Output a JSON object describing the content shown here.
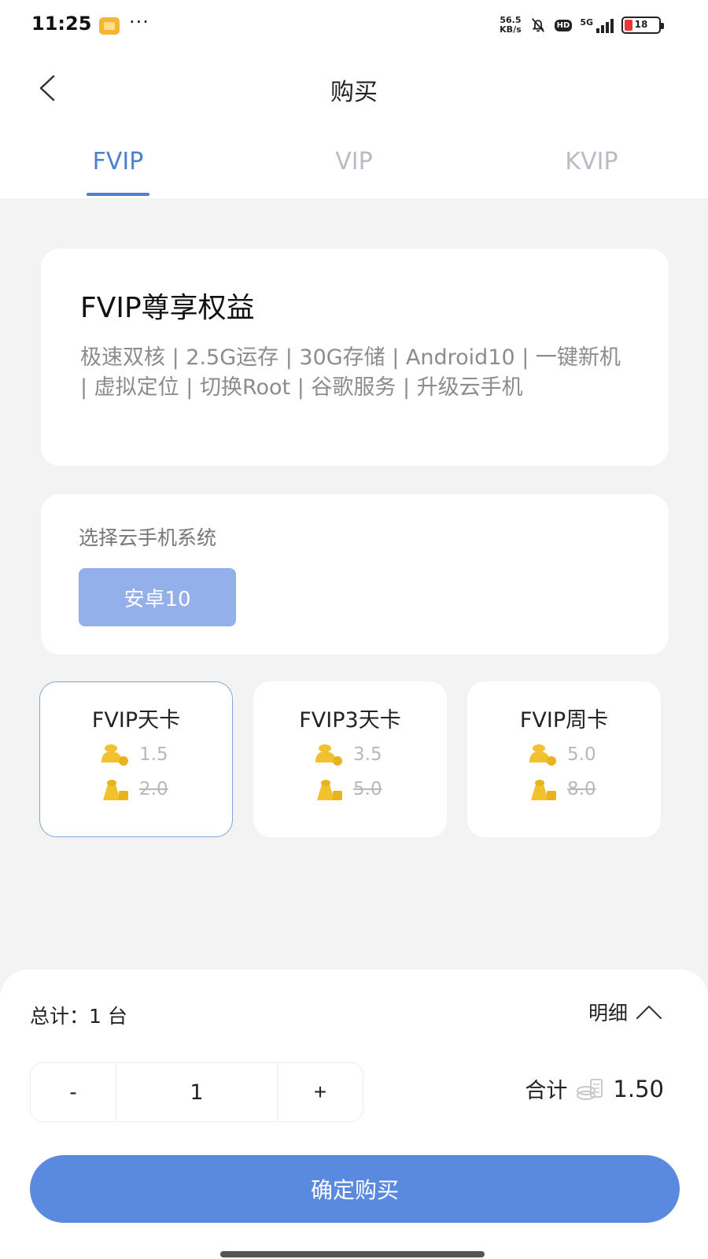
{
  "status_bar": {
    "time": "11:25",
    "more": "···",
    "net_speed_top": "56.5",
    "net_speed_bottom": "KB/s",
    "hd": "HD",
    "signal": "5G",
    "battery": "18"
  },
  "nav": {
    "title": "购买"
  },
  "tabs": [
    {
      "label": "FVIP",
      "active": true
    },
    {
      "label": "VIP",
      "active": false
    },
    {
      "label": "KVIP",
      "active": false
    }
  ],
  "benefits": {
    "title": "FVIP尊享权益",
    "description": "极速双核 | 2.5G运存 | 30G存储 | Android10 | 一键新机 | 虚拟定位 | 切换Root | 谷歌服务 | 升级云手机"
  },
  "system": {
    "label": "选择云手机系统",
    "option": "安卓10"
  },
  "plans": [
    {
      "name": "FVIP天卡",
      "price": "1.5",
      "original_price": "2.0",
      "selected": true
    },
    {
      "name": "FVIP3天卡",
      "price": "3.5",
      "original_price": "5.0",
      "selected": false
    },
    {
      "name": "FVIP周卡",
      "price": "5.0",
      "original_price": "8.0",
      "selected": false
    }
  ],
  "summary": {
    "total_label": "总计：1 台",
    "detail_label": "明细",
    "minus": "-",
    "quantity": "1",
    "plus": "+",
    "sum_label": "合计",
    "sum_value": "1.50"
  },
  "buy_button": "确定购买",
  "colors": {
    "accent": "#5a8ae0",
    "tab_active": "#4f7fcf",
    "coin": "#f2c12e",
    "page_bg": "#f3f3f3"
  }
}
